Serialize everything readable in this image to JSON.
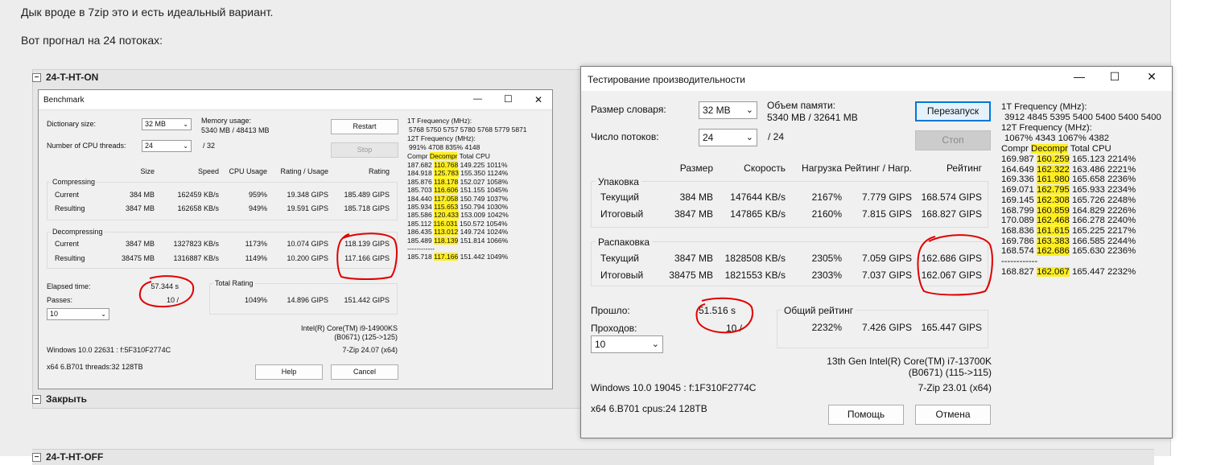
{
  "post": {
    "line1": "Дык вроде в 7zip это и есть идеальный вариант.",
    "line2": "Вот прогнал на 24 потоках:"
  },
  "spoiler": {
    "title": "24-T-HT-ON",
    "close": "Закрыть",
    "next_title": "24-T-HT-OFF",
    "toggle": "−"
  },
  "bench_en": {
    "title": "Benchmark",
    "dict_label": "Dictionary size:",
    "dict_value": "32 MB",
    "threads_label": "Number of CPU threads:",
    "threads_value": "24",
    "threads_of": "/ 32",
    "mem_label": "Memory usage:",
    "mem_value": "5340 MB / 48413 MB",
    "restart": "Restart",
    "stop": "Stop",
    "columns": [
      "Size",
      "Speed",
      "CPU Usage",
      "Rating / Usage",
      "Rating"
    ],
    "compressing": "Compressing",
    "decompressing": "Decompressing",
    "rows_comp": [
      {
        "label": "Current",
        "size": "384 MB",
        "speed": "162459 KB/s",
        "usage": "959%",
        "rpu": "19.348 GIPS",
        "rating": "185.489 GIPS"
      },
      {
        "label": "Resulting",
        "size": "3847 MB",
        "speed": "162658 KB/s",
        "usage": "949%",
        "rpu": "19.591 GIPS",
        "rating": "185.718 GIPS"
      }
    ],
    "rows_decomp": [
      {
        "label": "Current",
        "size": "3847 MB",
        "speed": "1327823 KB/s",
        "usage": "1173%",
        "rpu": "10.074 GIPS",
        "rating": "118.139 GIPS"
      },
      {
        "label": "Resulting",
        "size": "38475 MB",
        "speed": "1316887 KB/s",
        "usage": "1149%",
        "rpu": "10.200 GIPS",
        "rating": "117.166 GIPS"
      }
    ],
    "elapsed_label": "Elapsed time:",
    "elapsed_value": "57.344 s",
    "passes_label": "Passes:",
    "passes_value": "10 /",
    "passes_select": "10",
    "total_label": "Total Rating",
    "total": {
      "usage": "1049%",
      "rpu": "14.896 GIPS",
      "rating": "151.442 GIPS"
    },
    "cpu_line1": "Intel(R) Core(TM) i9-14900KS",
    "cpu_line2": "(B0671) (125->125)",
    "os": "Windows 10.0 22631 : f:5F310F2774C",
    "version": "7-Zip 24.07 (x64)",
    "sys": "x64 6.B701 threads:32 128TB",
    "help": "Help",
    "cancel": "Cancel",
    "freq1_label": "1T Frequency (MHz):",
    "freq1": "5768 5750 5757 5780 5768 5779 5871",
    "freqN_label": "12T Frequency (MHz):",
    "freqN": "991% 4708 835% 4148",
    "table_header": [
      "Compr",
      "Decompr",
      "Total",
      "CPU"
    ],
    "table": [
      [
        "187.682",
        "110.768",
        "149.225",
        "1011%"
      ],
      [
        "184.918",
        "125.783",
        "155.350",
        "1124%"
      ],
      [
        "185.876",
        "118.178",
        "152.027",
        "1058%"
      ],
      [
        "185.703",
        "116.606",
        "151.155",
        "1045%"
      ],
      [
        "184.440",
        "117.058",
        "150.749",
        "1037%"
      ],
      [
        "185.934",
        "115.653",
        "150.794",
        "1030%"
      ],
      [
        "185.586",
        "120.433",
        "153.009",
        "1042%"
      ],
      [
        "185.112",
        "116.031",
        "150.572",
        "1054%"
      ],
      [
        "186.435",
        "113.012",
        "149.724",
        "1024%"
      ],
      [
        "185.489",
        "118.139",
        "151.814",
        "1066%"
      ]
    ],
    "sep": "------------",
    "table_total": [
      "185.718",
      "117.166",
      "151.442",
      "1049%"
    ]
  },
  "bench_ru": {
    "title": "Тестирование производительности",
    "dict_label": "Размер словаря:",
    "dict_value": "32 MB",
    "threads_label": "Число потоков:",
    "threads_value": "24",
    "threads_of": "/ 24",
    "mem_label": "Объем памяти:",
    "mem_value": "5340 MB / 32641 MB",
    "restart": "Перезапуск",
    "stop": "Стоп",
    "columns": [
      "Размер",
      "Скорость",
      "Нагрузка",
      "Рейтинг / Нагр.",
      "Рейтинг"
    ],
    "compressing": "Упаковка",
    "decompressing": "Распаковка",
    "rows_comp": [
      {
        "label": "Текущий",
        "size": "384 MB",
        "speed": "147644 KB/s",
        "usage": "2167%",
        "rpu": "7.779 GIPS",
        "rating": "168.574 GIPS"
      },
      {
        "label": "Итоговый",
        "size": "3847 MB",
        "speed": "147865 KB/s",
        "usage": "2160%",
        "rpu": "7.815 GIPS",
        "rating": "168.827 GIPS"
      }
    ],
    "rows_decomp": [
      {
        "label": "Текущий",
        "size": "3847 MB",
        "speed": "1828508 KB/s",
        "usage": "2305%",
        "rpu": "7.059 GIPS",
        "rating": "162.686 GIPS"
      },
      {
        "label": "Итоговый",
        "size": "38475 MB",
        "speed": "1821553 KB/s",
        "usage": "2303%",
        "rpu": "7.037 GIPS",
        "rating": "162.067 GIPS"
      }
    ],
    "elapsed_label": "Прошло:",
    "elapsed_value": "51.516 s",
    "passes_label": "Проходов:",
    "passes_value": "10 /",
    "passes_select": "10",
    "total_label": "Общий рейтинг",
    "total": {
      "usage": "2232%",
      "rpu": "7.426 GIPS",
      "rating": "165.447 GIPS"
    },
    "cpu_line1": "13th Gen Intel(R) Core(TM) i7-13700K",
    "cpu_line2": "(B0671) (115->115)",
    "os": "Windows 10.0 19045 : f:1F310F2774C",
    "version": "7-Zip 23.01 (x64)",
    "sys": "x64 6.B701 cpus:24 128TB",
    "help": "Помощь",
    "cancel": "Отмена",
    "freq1_label": "1T Frequency (MHz):",
    "freq1": "3912 4845 5395 5400 5400 5400 5400",
    "freqN_label": "12T Frequency (MHz):",
    "freqN": "1067% 4343 1067% 4382",
    "table_header": [
      "Compr",
      "Decompr",
      "Total",
      "CPU"
    ],
    "table": [
      [
        "169.987",
        "160.259",
        "165.123",
        "2214%"
      ],
      [
        "164.649",
        "162.322",
        "163.486",
        "2221%"
      ],
      [
        "169.336",
        "161.980",
        "165.658",
        "2236%"
      ],
      [
        "169.071",
        "162.795",
        "165.933",
        "2234%"
      ],
      [
        "169.145",
        "162.308",
        "165.726",
        "2248%"
      ],
      [
        "168.799",
        "160.859",
        "164.829",
        "2226%"
      ],
      [
        "170.089",
        "162.468",
        "166.278",
        "2240%"
      ],
      [
        "168.836",
        "161.615",
        "165.225",
        "2217%"
      ],
      [
        "169.786",
        "163.383",
        "166.585",
        "2244%"
      ],
      [
        "168.574",
        "162.686",
        "165.630",
        "2236%"
      ]
    ],
    "sep": "------------",
    "table_total": [
      "168.827",
      "162.067",
      "165.447",
      "2232%"
    ]
  },
  "window_controls": {
    "minimize": "—",
    "maximize": "☐",
    "close": "✕"
  },
  "colors": {
    "highlight": "#ffee22",
    "annotation": "#e00000",
    "primary_border": "#0078d7"
  }
}
